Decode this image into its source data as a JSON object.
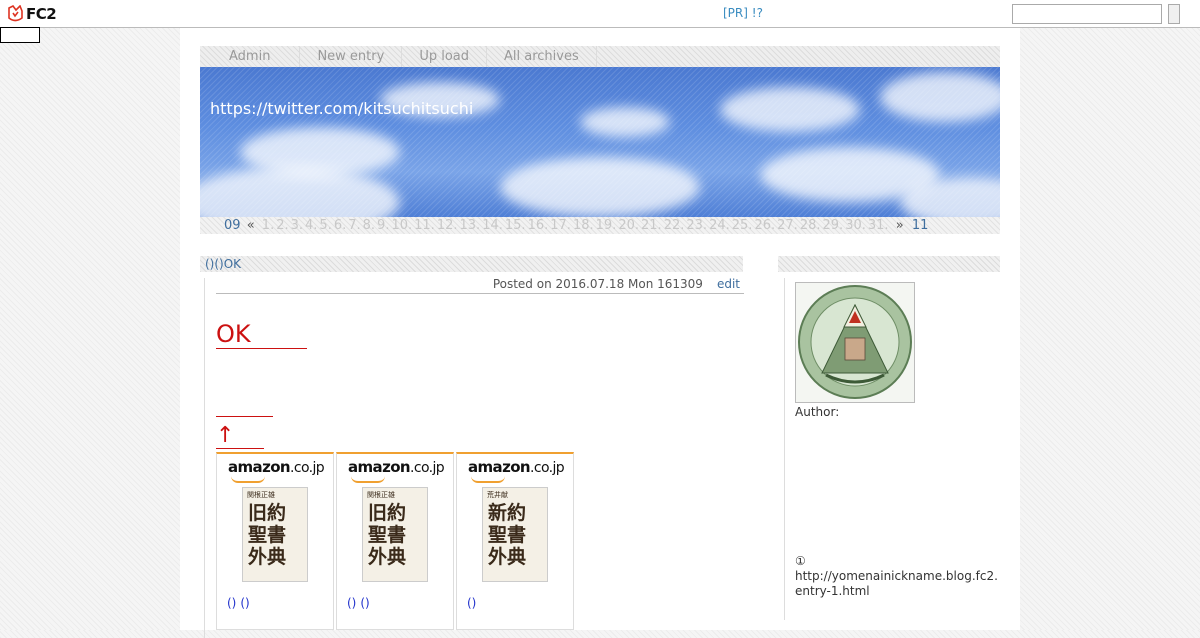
{
  "topbar": {
    "logo_text": "FC2",
    "pr_link": "[PR] !?",
    "search_placeholder": "",
    "search_button_label": ""
  },
  "menu": {
    "items": [
      {
        "label": "Admin"
      },
      {
        "label": "New entry"
      },
      {
        "label": "Up load"
      },
      {
        "label": "All archives"
      }
    ]
  },
  "header": {
    "blog_title": "https://twitter.com/kitsuchitsuchi"
  },
  "calendar": {
    "prev_month": "09",
    "arrow_prev": "«",
    "days": [
      "1.",
      "2.",
      "3.",
      "4.",
      "5.",
      "6.",
      "7.",
      "8.",
      "9.",
      "10.",
      "11.",
      "12.",
      "13.",
      "14.",
      "15.",
      "16.",
      "17.",
      "18.",
      "19.",
      "20.",
      "21.",
      "22.",
      "23.",
      "24.",
      "25.",
      "26.",
      "27.",
      "28.",
      "29.",
      "30.",
      "31."
    ],
    "arrow_next": "»",
    "next_month": "11"
  },
  "entry": {
    "title": "()()OK",
    "meta": "Posted on 2016.07.18 Mon 161309",
    "edit_label": "edit",
    "heading": "OK",
    "arrow": "↑"
  },
  "amazon": {
    "logo_text": "amazon",
    "logo_suffix": ".co.jp",
    "items": [
      {
        "book_text": "旧約聖書外典",
        "book_author": "関根正雄",
        "links": [
          "()",
          "()"
        ]
      },
      {
        "book_text": "旧約聖書外典",
        "book_author": "関根正雄",
        "links": [
          "()",
          "()"
        ]
      },
      {
        "book_text": "新約聖書外典",
        "book_author": "荒井献",
        "links": [
          "()"
        ]
      }
    ]
  },
  "sidebar": {
    "author_label": "Author:",
    "note_number": "①",
    "note_url": "http://yomenainickname.blog.fc2.",
    "note_url_2": "entry-1.html"
  }
}
